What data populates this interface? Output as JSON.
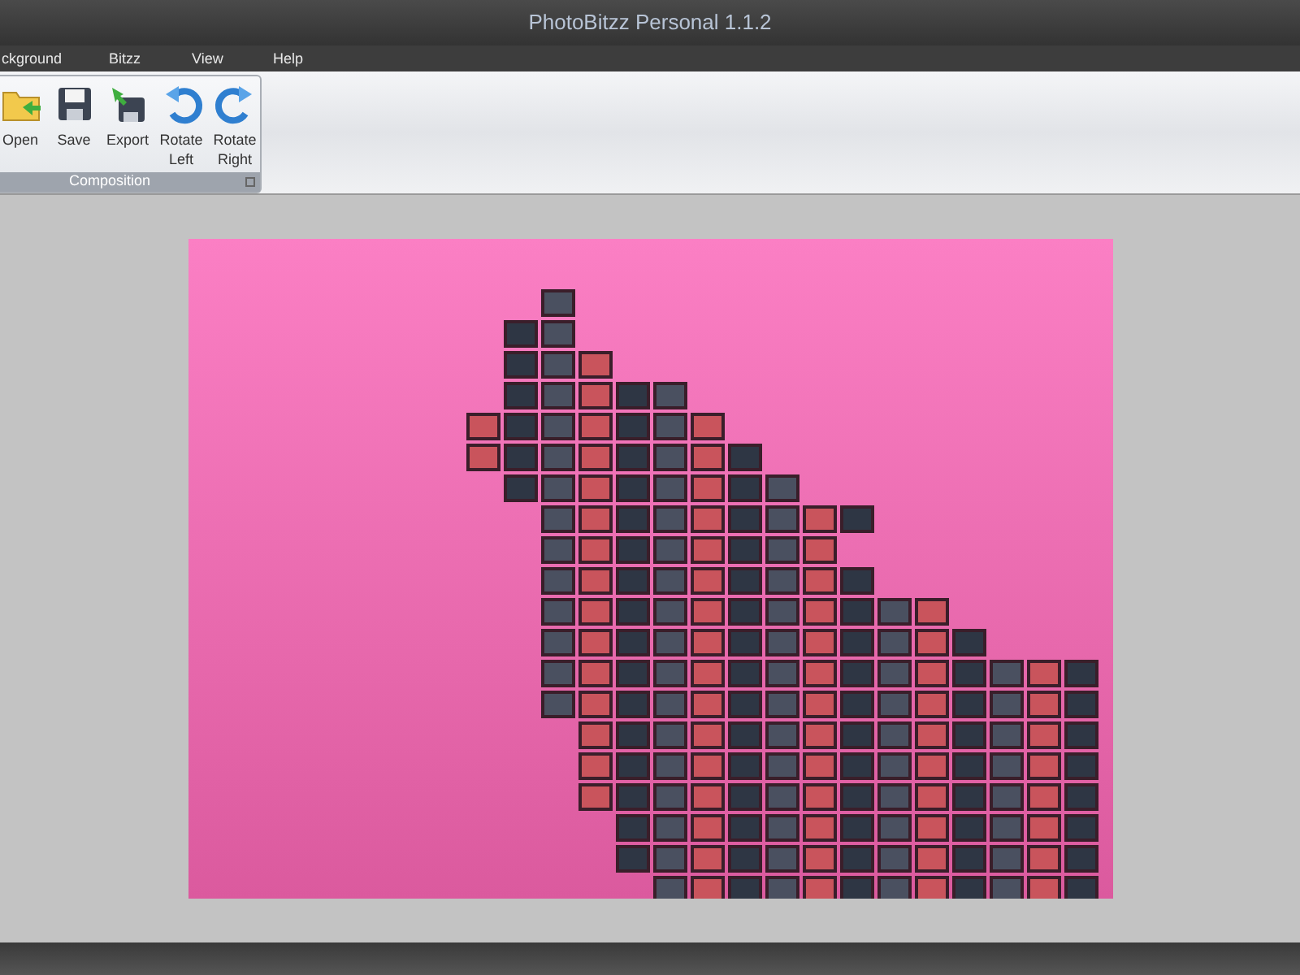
{
  "window": {
    "title": "PhotoBitzz Personal 1.1.2"
  },
  "menu": [
    {
      "label": "ckground"
    },
    {
      "label": "Bitzz"
    },
    {
      "label": "View"
    },
    {
      "label": "Help"
    }
  ],
  "ribbon_group": {
    "label": "Composition",
    "buttons": [
      {
        "kind": "open",
        "label": "Open"
      },
      {
        "kind": "save",
        "label": "Save"
      },
      {
        "kind": "export",
        "label": "Export"
      },
      {
        "kind": "rotate_left",
        "label": "Rotate Left"
      },
      {
        "kind": "rotate_right",
        "label": "Rotate Right"
      }
    ]
  }
}
